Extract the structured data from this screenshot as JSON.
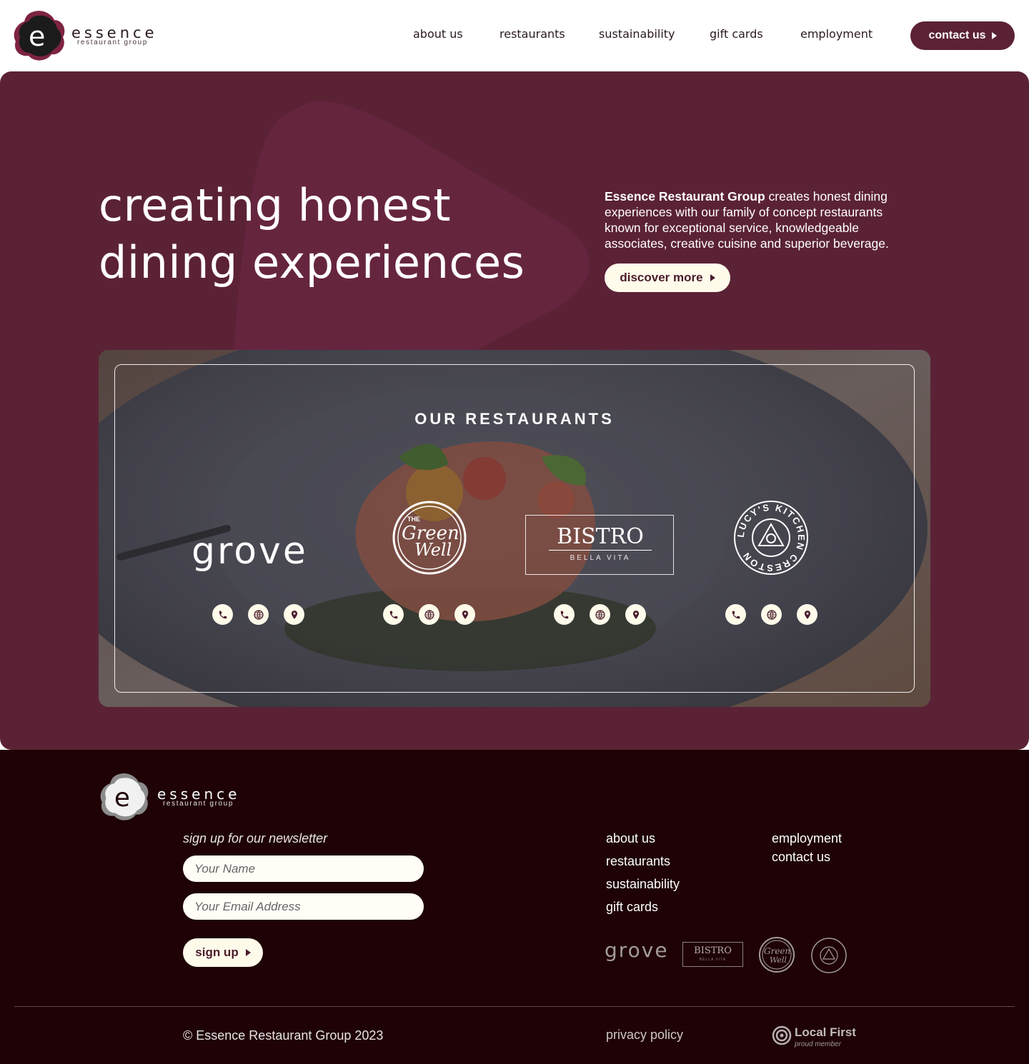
{
  "brand": {
    "name": "essence",
    "tagline": "restaurant group"
  },
  "nav": {
    "items": [
      {
        "label": "about us"
      },
      {
        "label": "restaurants"
      },
      {
        "label": "sustainability"
      },
      {
        "label": "gift cards"
      },
      {
        "label": "employment"
      }
    ],
    "contact_label": "contact us"
  },
  "hero": {
    "title_line1": "creating honest",
    "title_line2": "dining experiences",
    "desc_bold": "Essence Restaurant Group",
    "desc_rest": " creates honest dining experiences with our family of concept restaurants known for exceptional service, knowledgeable associates, creative cuisine and superior beverage.",
    "button_label": "discover more"
  },
  "restaurants": {
    "heading": "OUR RESTAURANTS",
    "items": [
      {
        "name": "grove"
      },
      {
        "name": "The Green Well",
        "logo_top": "THE",
        "logo_main": "Green",
        "logo_bottom": "Well"
      },
      {
        "name": "BISTRO",
        "sub": "BELLA VITA"
      },
      {
        "name": "Lucy's Kitchen Creston",
        "ring_text": "LUCY'S KITCHEN CRESTON"
      }
    ],
    "icon_names": [
      "phone-icon",
      "globe-icon",
      "map-pin-icon"
    ]
  },
  "footer": {
    "newsletter_label": "sign up for our newsletter",
    "name_placeholder": "Your Name",
    "email_placeholder": "Your Email Address",
    "signup_label": "sign up",
    "links_col1": [
      "about us",
      "restaurants",
      "sustainability",
      "gift cards"
    ],
    "links_col2": [
      "employment",
      "contact us"
    ],
    "copyright": "© Essence Restaurant Group 2023",
    "privacy": "privacy policy",
    "local_first": "Local First",
    "local_first_sub": "proud member"
  },
  "colors": {
    "brand_maroon": "#5b2236",
    "footer_bg": "#1e0205",
    "cream": "#fffbea"
  }
}
